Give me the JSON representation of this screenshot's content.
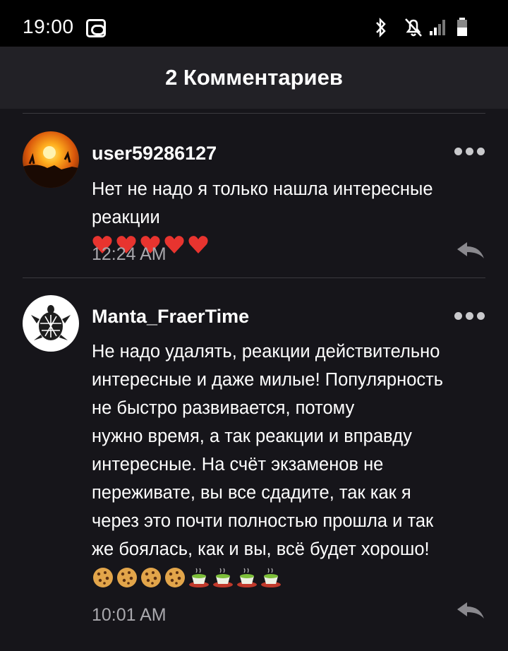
{
  "status_bar": {
    "time": "19:00"
  },
  "header": {
    "title": "2 Комментариев"
  },
  "comments": [
    {
      "username": "user59286127",
      "text": "Нет не надо я только нашла интересные реакции",
      "emojis": [
        "heart",
        "heart",
        "heart",
        "heart",
        "heart"
      ],
      "time": "12:24 AM"
    },
    {
      "username": "Manta_FraerTime",
      "lines": [
        "Не надо удалять, реакции действительно",
        "интересные и даже милые! Популярность",
        "не быстро развивается, потому",
        "нужно время, а так реакции и вправду",
        "интересные. На счёт экзаменов не",
        "переживате, вы все сдадите, так как я",
        "через это почти полностью прошла и так",
        "же боялась, как и вы, всё будет хорошо!"
      ],
      "emojis": [
        "cookie",
        "cookie",
        "cookie",
        "cookie",
        "tea",
        "tea",
        "tea",
        "tea"
      ],
      "time": "10:01 AM"
    }
  ],
  "colors": {
    "background": "#16151a",
    "header": "#222126",
    "timestamp": "#a9a8ad",
    "heart": "#e8342f"
  }
}
